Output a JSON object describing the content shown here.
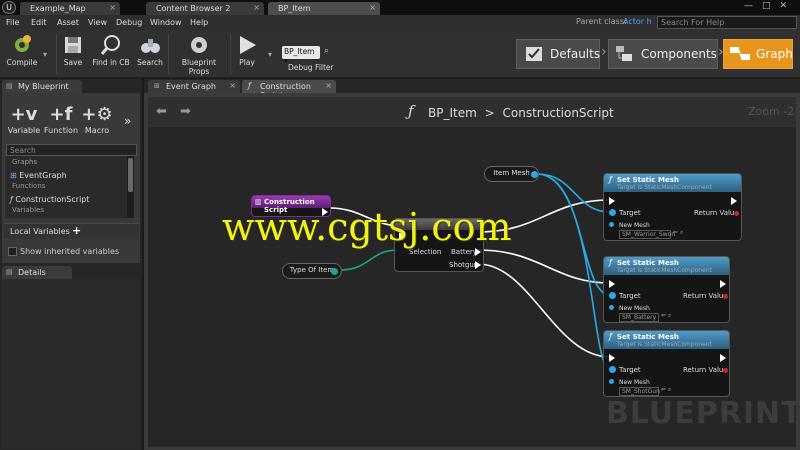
{
  "tabs": {
    "map": "Example_Map",
    "content_browser": "Content Browser 2",
    "bp_item": "BP_Item"
  },
  "menu": {
    "file": "File",
    "edit": "Edit",
    "asset": "Asset",
    "view": "View",
    "debug": "Debug",
    "window": "Window",
    "help": "Help"
  },
  "parent_class": {
    "label": "Parent class:",
    "value": "Actor h"
  },
  "help_search": {
    "placeholder": "Search For Help"
  },
  "toolbar": {
    "compile": "Compile",
    "save": "Save",
    "find_in_cb": "Find in CB",
    "search": "Search",
    "blueprint_props": "Blueprint Props",
    "play": "Play",
    "debug_box": "BP_Item",
    "debug_filter": "Debug Filter"
  },
  "modes": {
    "defaults": "Defaults",
    "components": "Components",
    "graph": "Graph"
  },
  "my_blueprint": {
    "tab": "My Blueprint",
    "add_variable": "Variable",
    "add_function": "Function",
    "add_macro": "Macro",
    "search_placeholder": "Search",
    "graphs_header": "Graphs",
    "event_graph": "EventGraph",
    "functions_header": "Functions",
    "construction_script": "ConstructionScript",
    "variables_header": "Variables",
    "local_variables": "Local Variables",
    "show_inherited": "Show inherited variables"
  },
  "details": {
    "tab": "Details"
  },
  "graph_tabs": {
    "event_graph": "Event Graph",
    "construction_script": "Construction Script"
  },
  "graph": {
    "breadcrumb_root": "BP_Item",
    "breadcrumb_sep": ">",
    "breadcrumb_leaf": "ConstructionScript",
    "zoom": "Zoom -2",
    "watermark": "BLUEPRINT",
    "overlay_watermark": "www.cgtsj.com"
  },
  "nodes": {
    "construction_script": {
      "title": "Construction Script"
    },
    "item_mesh": {
      "title": "Item Mesh"
    },
    "type_of_item": {
      "title": "Type Of Item"
    },
    "switch": {
      "selection": "Selection",
      "out1": "Battery",
      "out2": "Shotgun"
    },
    "set_mesh_1": {
      "title": "Set Static Mesh",
      "subtitle": "Target is StaticMeshComponent",
      "target": "Target",
      "return": "Return Value",
      "new_mesh": "New Mesh",
      "value": "SM_Warrior_Swon"
    },
    "set_mesh_2": {
      "title": "Set Static Mesh",
      "subtitle": "Target is StaticMeshComponent",
      "target": "Target",
      "return": "Return Value",
      "new_mesh": "New Mesh",
      "value": "SM_Battery"
    },
    "set_mesh_3": {
      "title": "Set Static Mesh",
      "subtitle": "Target is StaticMeshComponent",
      "target": "Target",
      "return": "Return Value",
      "new_mesh": "New Mesh",
      "value": "SM_ShotGun"
    }
  },
  "colors": {
    "accent_orange": "#e8951e",
    "node_blue": "#2d7fb0",
    "wire_blue": "#2aa9e6",
    "event_purple": "#7b2b91",
    "watermark_yellow": "#f2f215"
  }
}
